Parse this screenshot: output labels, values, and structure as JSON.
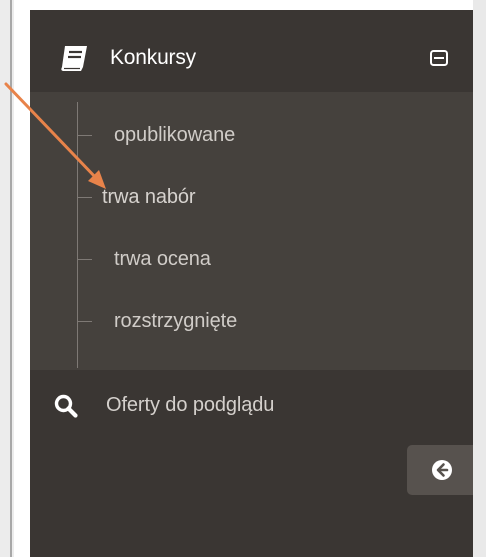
{
  "sidebar": {
    "menu": {
      "title": "Konkursy",
      "icon": "book-icon",
      "collapse_icon": "minus-square-icon",
      "items": [
        {
          "label": "opublikowane"
        },
        {
          "label": "trwa nabór"
        },
        {
          "label": "trwa ocena"
        },
        {
          "label": "rozstrzygnięte"
        }
      ]
    },
    "offers": {
      "label": "Oferty do podglądu",
      "icon": "search-icon"
    },
    "back_button": {
      "icon": "arrow-circle-left-icon"
    }
  },
  "colors": {
    "sidebar_bg": "#3a3633",
    "submenu_bg": "#45413d",
    "text_primary": "#ffffff",
    "text_secondary": "#d0ccc8",
    "annotation_arrow": "#e8834a"
  }
}
